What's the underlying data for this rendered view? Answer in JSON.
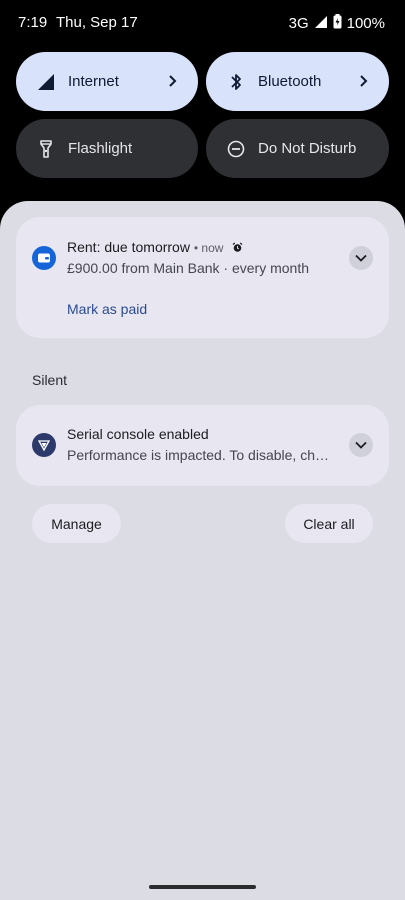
{
  "status": {
    "time": "7:19",
    "date": "Thu, Sep 17",
    "network": "3G",
    "battery": "100%"
  },
  "quick_settings": {
    "internet": {
      "label": "Internet",
      "icon": "signal-icon",
      "state": "on"
    },
    "bluetooth": {
      "label": "Bluetooth",
      "icon": "bluetooth-icon",
      "state": "on"
    },
    "flashlight": {
      "label": "Flashlight",
      "icon": "flashlight-icon",
      "state": "off"
    },
    "dnd": {
      "label": "Do Not Disturb",
      "icon": "minus-circle-icon",
      "state": "off"
    }
  },
  "notifications": {
    "rent": {
      "title": "Rent: due tomorrow",
      "time": "now",
      "body": "£900.00 from Main Bank · every month",
      "action": "Mark as paid",
      "icon": "wallet-icon",
      "alarm_icon": "alarm-icon"
    },
    "silent_label": "Silent",
    "serial": {
      "title": "Serial console enabled",
      "body": "Performance is impacted. To disable, check bootloader.",
      "icon": "shield-icon"
    }
  },
  "footer": {
    "manage": "Manage",
    "clear_all": "Clear all"
  },
  "colors": {
    "tile_on": "#d8e2fb",
    "tile_off": "#2f3034",
    "shade": "#dcdce4",
    "card": "#e8e7f1",
    "accent": "#2a4a8f"
  }
}
